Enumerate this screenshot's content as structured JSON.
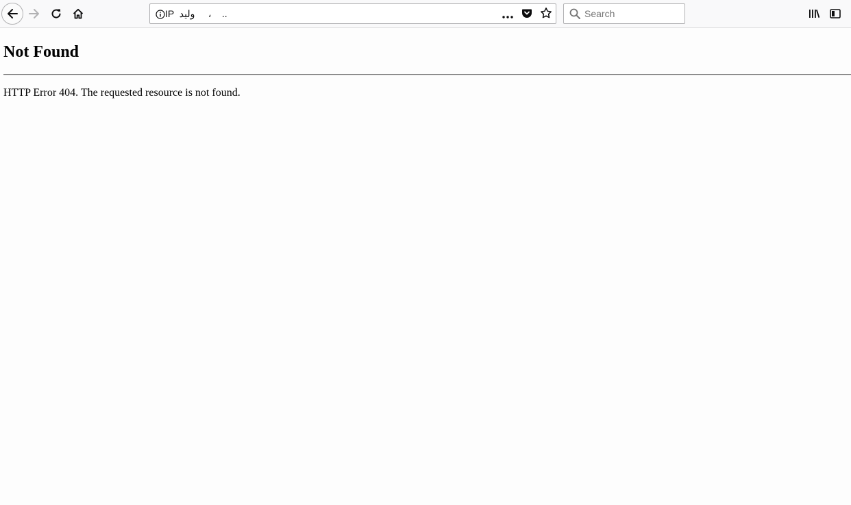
{
  "browser": {
    "url_text": "IP  وليد     ،    ..",
    "search_placeholder": "Search",
    "colors": {
      "toolbar_bg": "#f9f9fa",
      "icon": "#0c0c0d",
      "icon_disabled": "#b1b1b3"
    },
    "icons": [
      "back-icon",
      "forward-icon",
      "reload-icon",
      "home-icon",
      "info-icon",
      "more-icon",
      "pocket-icon",
      "star-icon",
      "search-icon",
      "library-icon",
      "sidebar-icon"
    ]
  },
  "page": {
    "title": "Not Found",
    "message": "HTTP Error 404. The requested resource is not found."
  }
}
